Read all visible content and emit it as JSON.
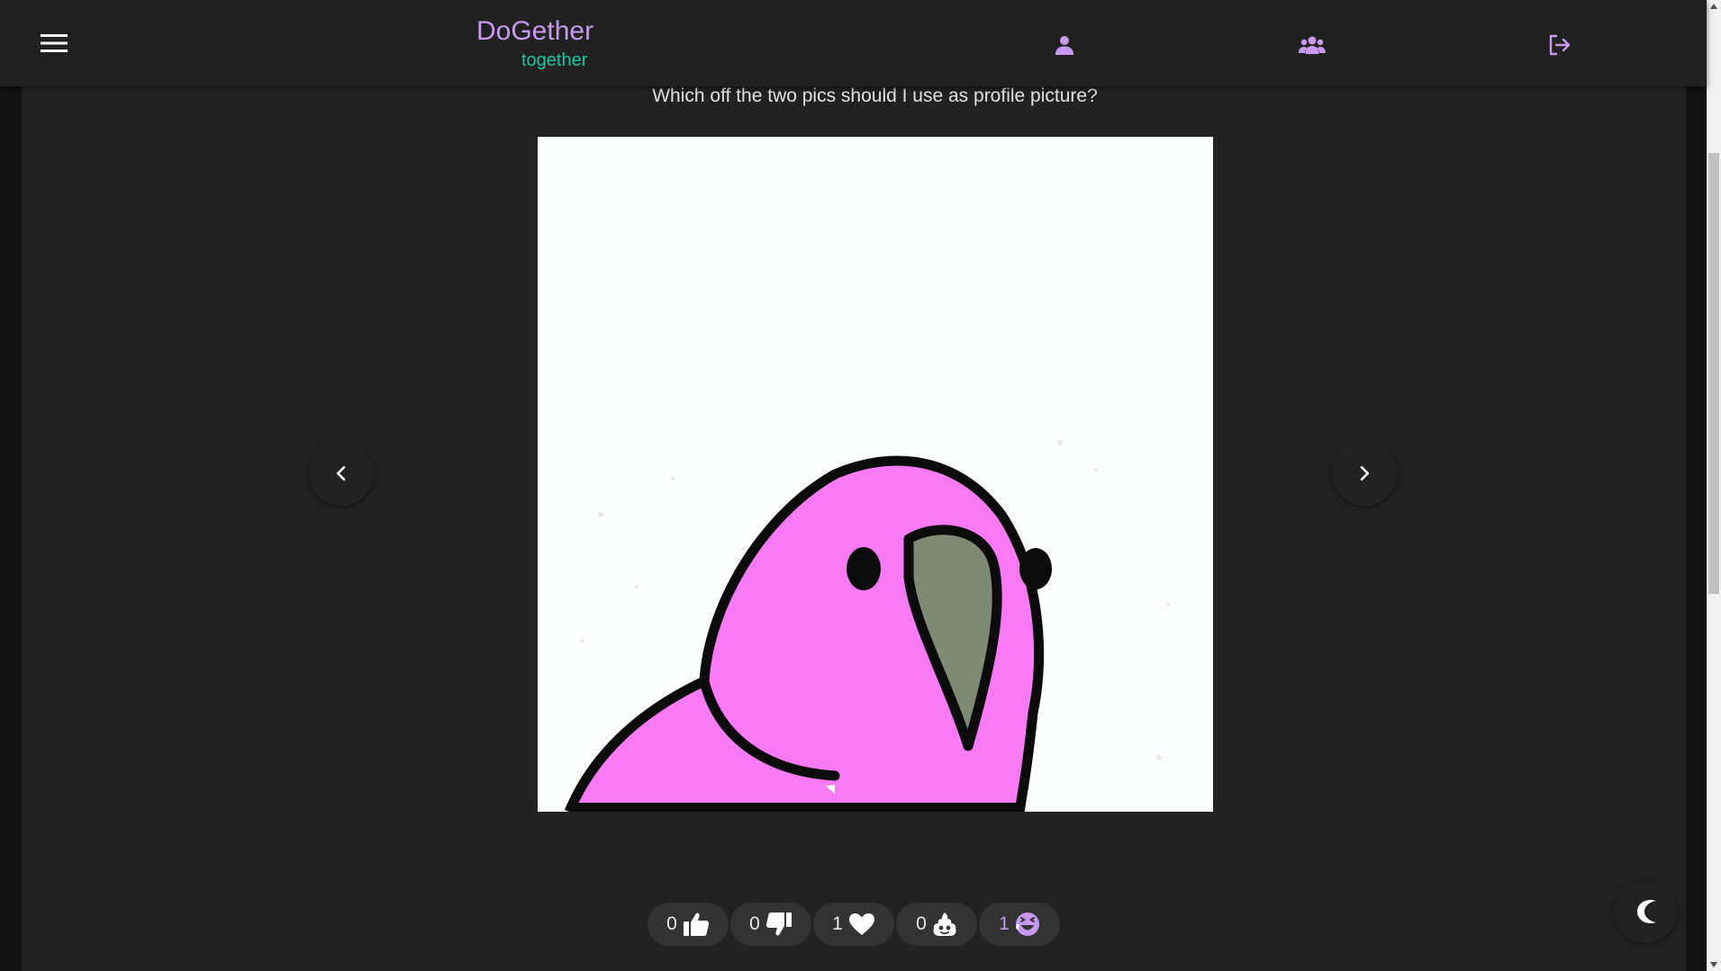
{
  "header": {
    "brand_title": "DoGether",
    "brand_subtitle": "together",
    "icons": {
      "menu": "hamburger-menu-icon",
      "profile": "person-icon",
      "groups": "group-icon",
      "logout": "logout-icon"
    }
  },
  "post": {
    "question": "Which off the two pics should I use as profile picture?",
    "image_subject": "pink party parrot"
  },
  "reactions": [
    {
      "name": "like",
      "count": "0",
      "icon": "thumbs-up-icon",
      "active": false
    },
    {
      "name": "dislike",
      "count": "0",
      "icon": "thumbs-down-icon",
      "active": false
    },
    {
      "name": "love",
      "count": "1",
      "icon": "heart-icon",
      "active": false
    },
    {
      "name": "poop",
      "count": "0",
      "icon": "poop-icon",
      "active": false
    },
    {
      "name": "laugh",
      "count": "1",
      "icon": "laugh-icon",
      "active": true
    }
  ],
  "colors": {
    "accent": "#c79af0",
    "accent_secondary": "#19c6a0",
    "header_bg": "#212121",
    "card_bg": "#222222",
    "chip_bg": "#333333"
  }
}
